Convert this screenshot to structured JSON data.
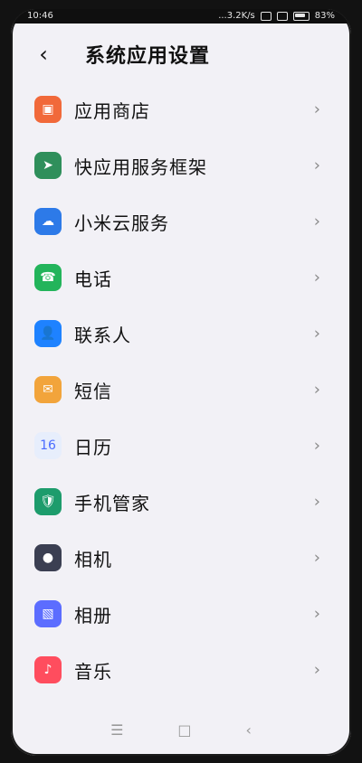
{
  "status_bar": {
    "time": "10:46",
    "network": "...3.2K/s",
    "battery": "83%"
  },
  "header": {
    "title": "系统应用设置",
    "back_icon": "chevron-left-icon"
  },
  "items": [
    {
      "label": "应用商店",
      "icon": "app-store-icon",
      "color": "#f1693a",
      "glyph": "▣"
    },
    {
      "label": "快应用服务框架",
      "icon": "quick-app-icon",
      "color": "#2f8f5b",
      "glyph": "➤"
    },
    {
      "label": "小米云服务",
      "icon": "cloud-icon",
      "color": "#2d7ae8",
      "glyph": "☁"
    },
    {
      "label": "电话",
      "icon": "phone-icon",
      "color": "#23b45b",
      "glyph": "☎"
    },
    {
      "label": "联系人",
      "icon": "contacts-icon",
      "color": "#1e82ff",
      "glyph": "👤"
    },
    {
      "label": "短信",
      "icon": "message-icon",
      "color": "#f2a43b",
      "glyph": "✉"
    },
    {
      "label": "日历",
      "icon": "calendar-icon",
      "color": "#e7eefc",
      "glyph": "16",
      "glyph_color": "#4a6cff"
    },
    {
      "label": "手机管家",
      "icon": "security-icon",
      "color": "#1d9c6c",
      "glyph": "🛡"
    },
    {
      "label": "相机",
      "icon": "camera-icon",
      "color": "#3b3f52",
      "glyph": "●"
    },
    {
      "label": "相册",
      "icon": "gallery-icon",
      "color": "#5c6dff",
      "glyph": "▧"
    },
    {
      "label": "音乐",
      "icon": "music-icon",
      "color": "#ff4d5e",
      "glyph": "♪"
    }
  ],
  "nav": {
    "menu_icon": "menu-icon",
    "home_icon": "home-icon",
    "back_icon": "back-icon"
  }
}
